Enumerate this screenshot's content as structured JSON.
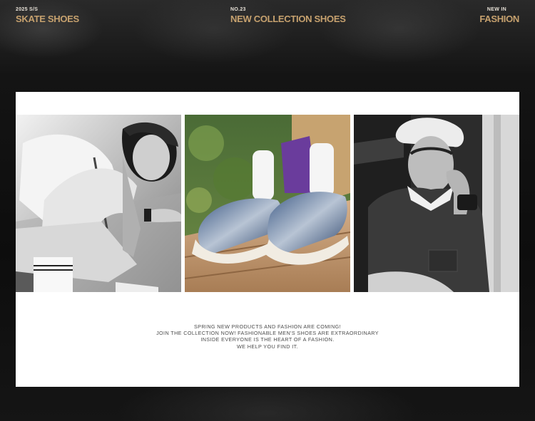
{
  "header": {
    "left": {
      "small": "2025 S/S",
      "big": "SKATE SHOES"
    },
    "center": {
      "small": "NO.23",
      "big": "NEW COLLECTION  SHOES"
    },
    "right": {
      "small": "NEW  IN",
      "big": "FASHION"
    }
  },
  "photos": [
    {
      "subject": "black-and-white skater sitting with knee up"
    },
    {
      "subject": "denim platform skate shoes close-up"
    },
    {
      "subject": "black-and-white man in cap and polo leaning in doorway"
    }
  ],
  "caption": {
    "line1": "SPRING NEW PRODUCTS AND FASHION ARE COMING!",
    "line2": "JOIN THE COLLECTION NOW! FASHIONABLE MEN'S SHOES ARE EXTRAORDINARY",
    "line3": "INSIDE EVERYONE IS THE HEART OF A FASHION.",
    "line4": "WE HELP YOU FIND IT."
  },
  "colors": {
    "accent": "#c6a16e",
    "background": "#0f0f0f",
    "card": "#ffffff"
  }
}
